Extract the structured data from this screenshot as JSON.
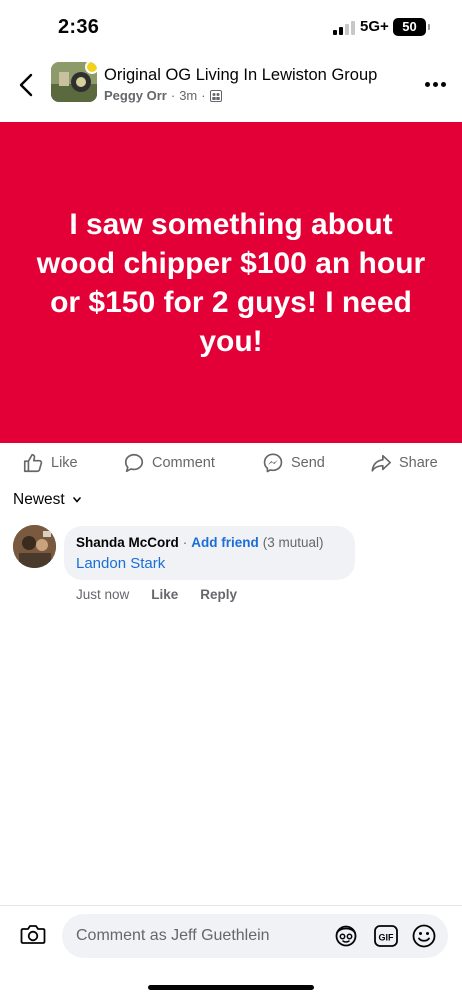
{
  "status_bar": {
    "time": "2:36",
    "network": "5G+",
    "battery": "50"
  },
  "header": {
    "group_name": "Original OG Living In Lewiston Group",
    "author": "Peggy Orr",
    "time_ago": "3m",
    "separator": "·"
  },
  "post": {
    "text": "I saw something about wood chipper $100 an hour or $150 for 2 guys! I need you!",
    "background_color": "#e20036"
  },
  "actions": {
    "like": "Like",
    "comment": "Comment",
    "send": "Send",
    "share": "Share"
  },
  "sort": {
    "label": "Newest"
  },
  "comment": {
    "author": "Shanda McCord",
    "separator": "·",
    "add_friend": "Add friend",
    "mutual": "(3 mutual)",
    "text": "Landon Stark",
    "time": "Just now",
    "like": "Like",
    "reply": "Reply"
  },
  "composer": {
    "placeholder": "Comment as Jeff Guethlein"
  },
  "icons": {
    "back": "chevron-left-icon",
    "more": "more-horizontal-icon",
    "like": "thumbs-up-icon",
    "comment": "comment-bubble-icon",
    "send": "messenger-icon",
    "share": "share-arrow-icon",
    "camera": "camera-icon",
    "avatar": "avatar-sticker-icon",
    "gif": "gif-icon",
    "emoji": "emoji-icon",
    "audience": "group-members-icon"
  }
}
